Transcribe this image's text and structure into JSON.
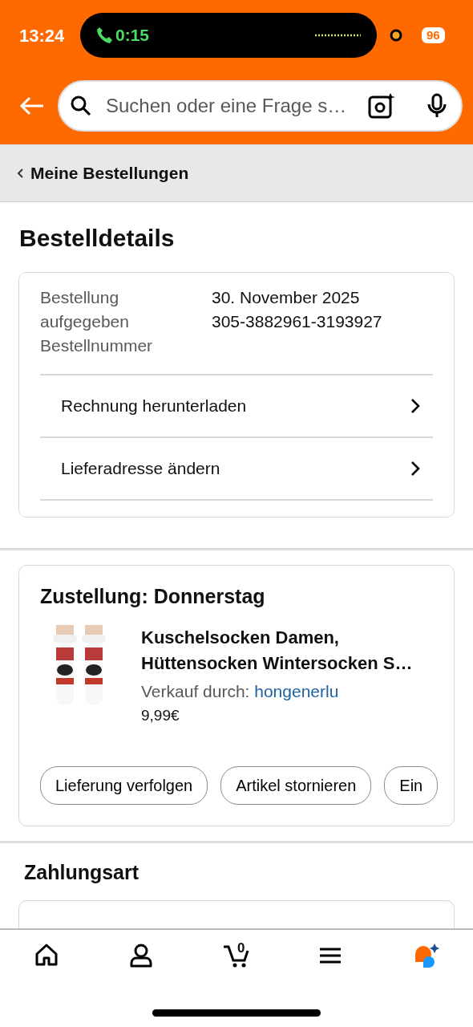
{
  "status_bar": {
    "time": "13:24",
    "call_timer": "0:15",
    "battery": "96"
  },
  "search": {
    "placeholder": "Suchen oder eine Frage s…"
  },
  "breadcrumb": {
    "label": "Meine Bestellungen"
  },
  "page_title": "Bestelldetails",
  "order": {
    "labels": [
      "Bestellung aufgegeben",
      "Bestellnummer"
    ],
    "values": [
      "30. November 2025",
      "305-3882961-3193927"
    ],
    "links": [
      "Rechnung herunterladen",
      "Lieferadresse ändern"
    ]
  },
  "shipment": {
    "title": "Zustellung: Donnerstag",
    "item": {
      "name": "Kuschelsocken Damen, Hüttensocken Wintersocken S…",
      "seller_label": "Verkauf durch:",
      "seller": "hongenerlu",
      "price": "9,99€"
    },
    "actions": [
      "Lieferung verfolgen",
      "Artikel stornieren",
      "Ein"
    ]
  },
  "payment": {
    "title": "Zahlungsart"
  },
  "bottom_nav": {
    "cart_count": "0"
  }
}
